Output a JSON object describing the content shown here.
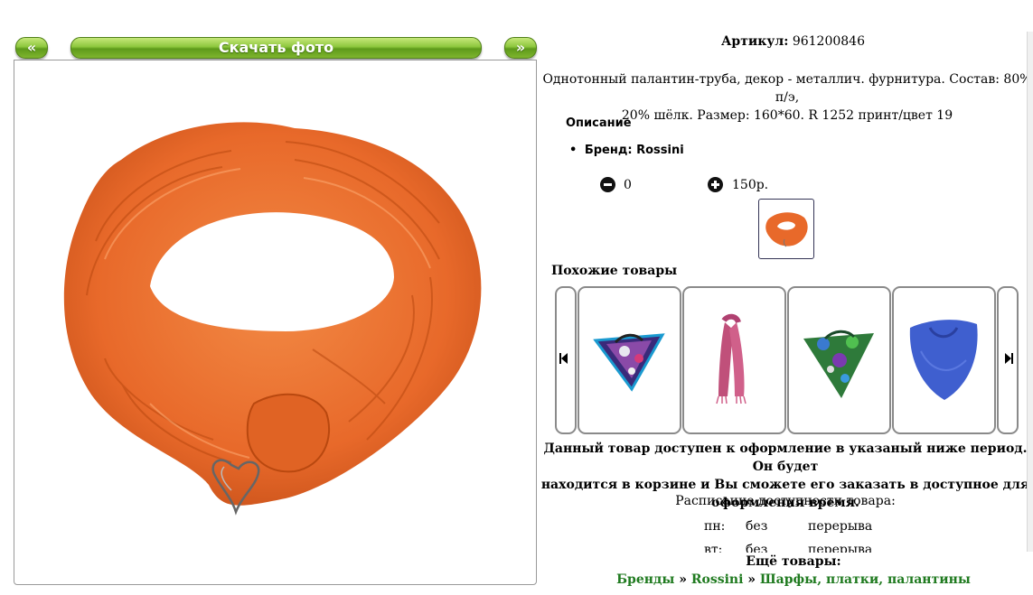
{
  "gallery": {
    "prev_label": "«",
    "download_label": "Скачать фото",
    "next_label": "»"
  },
  "product": {
    "article_label": "Артикул:",
    "article_value": "961200846",
    "description_line1": "Однотонный палантин-труба, декор - металлич. фурнитура. Состав: 80% п/э,",
    "description_line2": "20% шёлк. Размер: 160*60. R 1252 принт/цвет 19",
    "section_title": "Описание",
    "brand_item": "Бренд: Rossini",
    "quantity": "0",
    "price": "150р."
  },
  "similar": {
    "title": "Похожие товары"
  },
  "availability": {
    "notice_line1": "Данный товар доступен к оформление в указаный ниже период. Он будет",
    "notice_line2": "находится в корзине и Вы сможете его заказать в доступное для",
    "notice_line3": "оформления время.",
    "schedule_title": "Расписание доступности товара:",
    "rows": [
      {
        "day": "пн:",
        "from": "без",
        "to": "перерыва"
      },
      {
        "day": "вт:",
        "from": "без",
        "to": "перерыва"
      }
    ]
  },
  "more": {
    "title": "Ещё товары:",
    "crumb1": "Бренды",
    "sep": "»",
    "crumb2": "Rossini",
    "crumb3": "Шарфы, платки, палантины"
  },
  "colors": {
    "accent_green": "#7fb52e",
    "scarf_orange": "#e8692a",
    "link_green": "#1f7a1f"
  }
}
